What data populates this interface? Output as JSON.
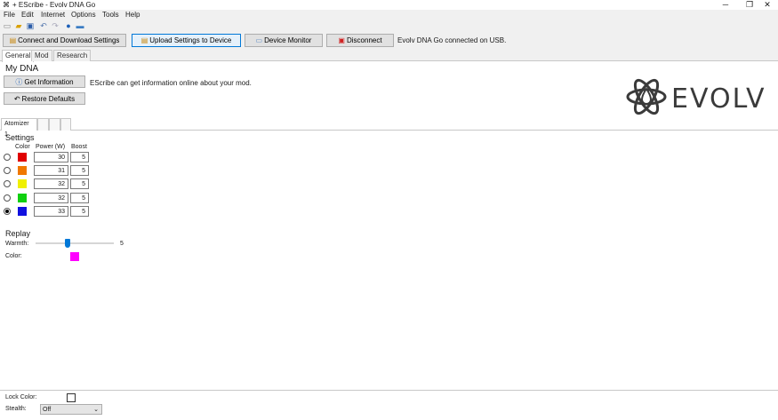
{
  "window": {
    "title": "+ EScribe - Evolv DNA Go",
    "app_icon": "⌘",
    "minimize": "─",
    "maximize": "❐",
    "close": "✕"
  },
  "menu": [
    "File",
    "Edit",
    "Internet",
    "Options",
    "Tools",
    "Help"
  ],
  "toolbar_icons": [
    "new-file-icon",
    "open-folder-icon",
    "save-icon",
    "undo-icon",
    "redo-icon",
    "globe-icon",
    "upload-icon"
  ],
  "actions": {
    "connect": "Connect and Download Settings",
    "upload": "Upload Settings to Device",
    "monitor": "Device Monitor",
    "disconnect": "Disconnect",
    "status": "Evolv DNA Go connected on USB."
  },
  "tabs": [
    "General",
    "Mod",
    "Research"
  ],
  "my_dna": {
    "title": "My DNA",
    "get_info": "Get Information",
    "get_info_desc": "EScribe can get information online about your mod.",
    "restore": "Restore Defaults"
  },
  "logo": {
    "word": "EVOLV"
  },
  "atomizer_tabs": [
    "Atomizer 1",
    "",
    ""
  ],
  "settings": {
    "title": "Settings",
    "col_color": "Color",
    "col_power": "Power (W)",
    "col_boost": "Boost",
    "rows": [
      {
        "color": "#e00000",
        "power": "30",
        "boost": "5",
        "selected": false
      },
      {
        "color": "#f07800",
        "power": "31",
        "boost": "5",
        "selected": false
      },
      {
        "color": "#f0f000",
        "power": "32",
        "boost": "5",
        "selected": false
      },
      {
        "color": "#10d010",
        "power": "32",
        "boost": "5",
        "selected": false
      },
      {
        "color": "#1010e0",
        "power": "33",
        "boost": "5",
        "selected": true
      }
    ]
  },
  "replay": {
    "title": "Replay",
    "warmth_label": "Warmth:",
    "warmth_value": "5",
    "color_label": "Color:",
    "color": "#ff00ff"
  },
  "footer": {
    "lock_color_label": "Lock Color:",
    "stealth_label": "Stealth:",
    "stealth_value": "Off"
  }
}
